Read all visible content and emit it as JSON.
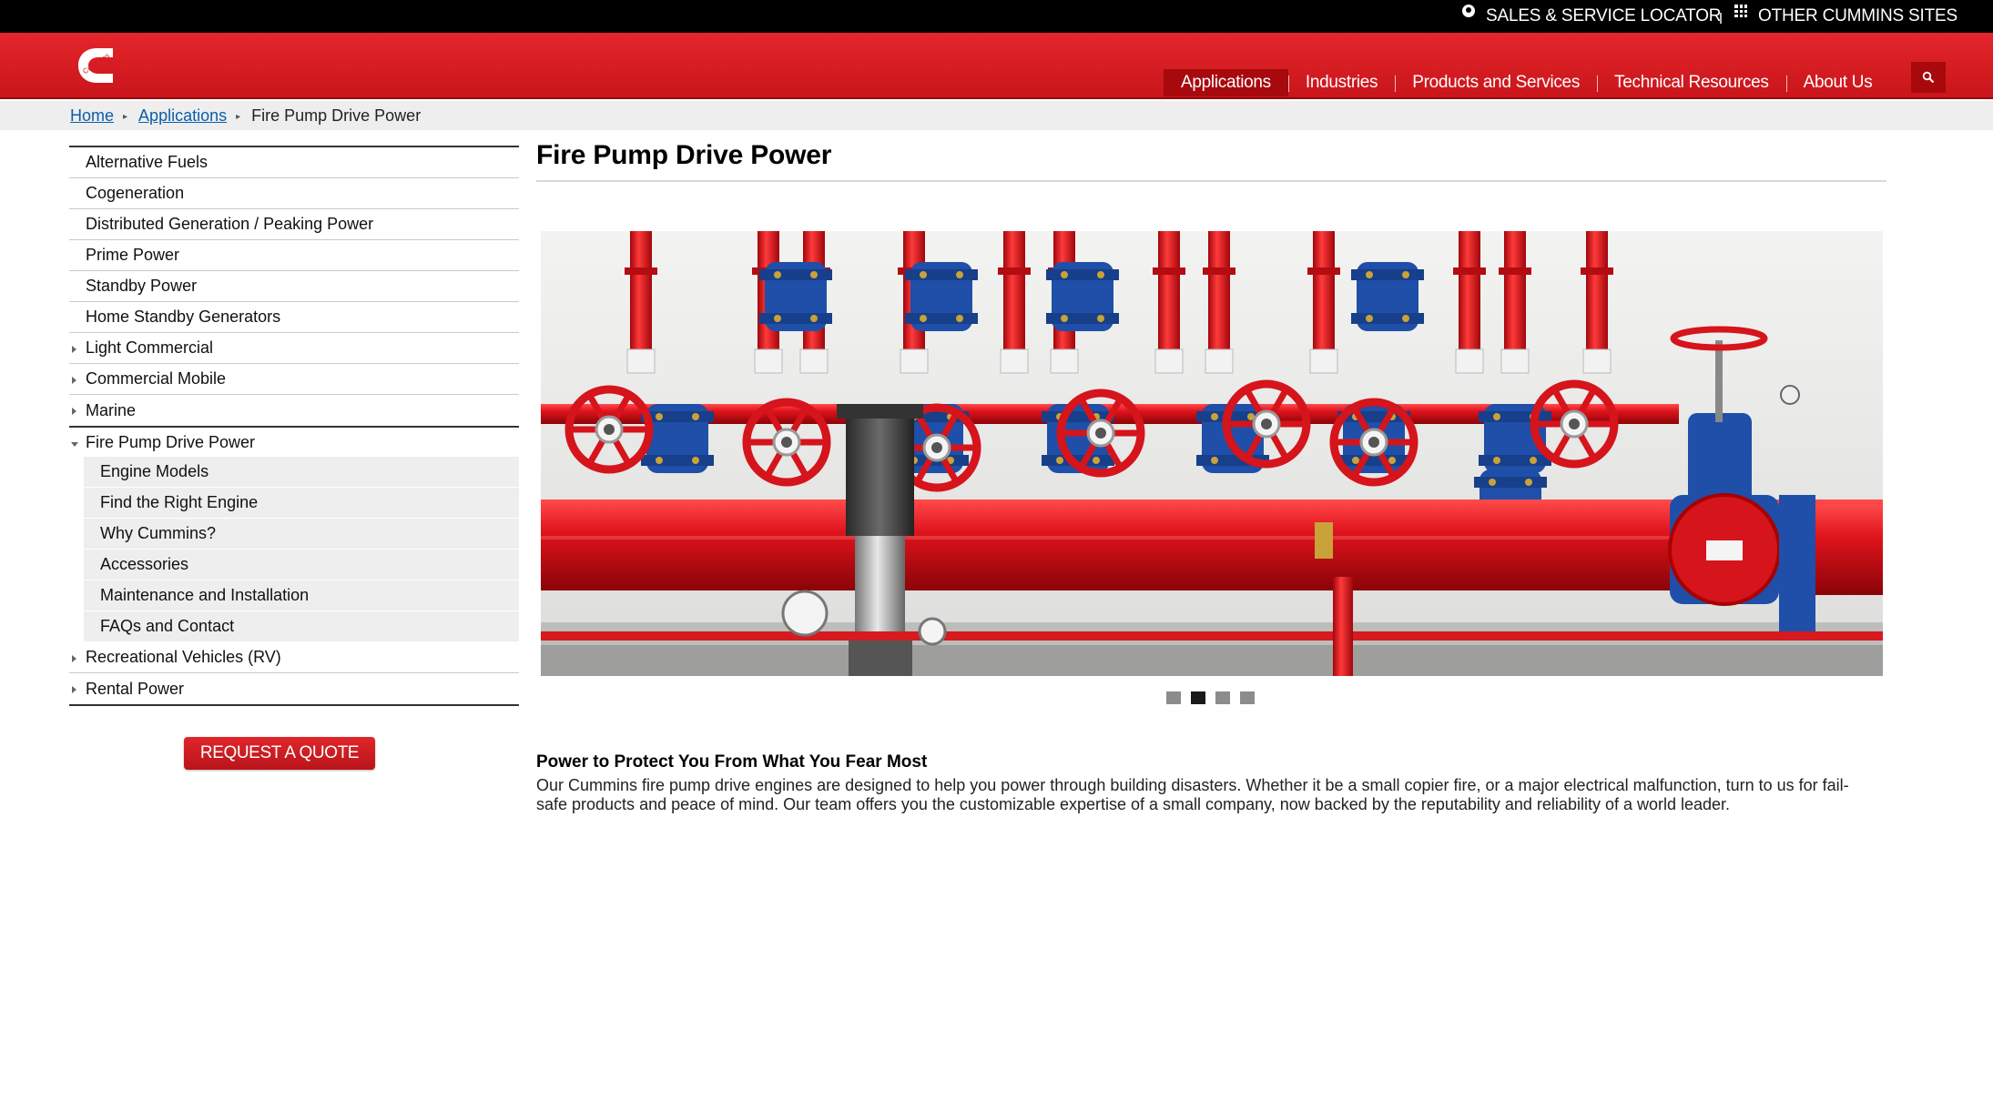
{
  "utility": {
    "locator": "SALES & SERVICE LOCATOR",
    "other_sites": "OTHER CUMMINS SITES"
  },
  "nav": {
    "items": [
      {
        "label": "Applications",
        "active": true
      },
      {
        "label": "Industries"
      },
      {
        "label": "Products and Services"
      },
      {
        "label": "Technical Resources"
      },
      {
        "label": "About Us"
      }
    ]
  },
  "breadcrumb": {
    "home": "Home",
    "applications": "Applications",
    "current": "Fire Pump Drive Power"
  },
  "sidebar": {
    "items": [
      {
        "label": "Alternative Fuels"
      },
      {
        "label": "Cogeneration"
      },
      {
        "label": "Distributed Generation / Peaking Power"
      },
      {
        "label": "Prime Power"
      },
      {
        "label": "Standby Power"
      },
      {
        "label": "Home Standby Generators"
      },
      {
        "label": "Light Commercial",
        "expandable": true
      },
      {
        "label": "Commercial Mobile",
        "expandable": true
      },
      {
        "label": "Marine",
        "expandable": true
      }
    ],
    "open_item": "Fire Pump Drive Power",
    "sub_items": [
      {
        "label": "Engine Models"
      },
      {
        "label": "Find the Right Engine"
      },
      {
        "label": "Why Cummins?"
      },
      {
        "label": "Accessories"
      },
      {
        "label": "Maintenance and Installation"
      },
      {
        "label": "FAQs and Contact"
      }
    ],
    "after_items": [
      {
        "label": "Recreational Vehicles (RV)",
        "expandable": true
      },
      {
        "label": "Rental Power",
        "expandable": true
      }
    ],
    "quote_button": "REQUEST A QUOTE"
  },
  "main": {
    "title": "Fire Pump Drive Power",
    "carousel": {
      "slides": 4,
      "active_index": 1
    },
    "subhead": "Power to Protect You From What You Fear Most",
    "body": "Our Cummins fire pump drive engines are designed to help you power through building disasters. Whether it be a small copier fire, or a major electrical malfunction, turn to us for fail-safe products and peace of mind. Our team offers you the customizable expertise of a small company, now backed by the reputability and reliability of a world leader."
  },
  "colors": {
    "brand_red": "#d71e24",
    "active_nav": "#a8090d",
    "link_blue": "#0b5ea8",
    "pipe_red": "#e0141c",
    "valve_blue": "#1f4fa8"
  }
}
